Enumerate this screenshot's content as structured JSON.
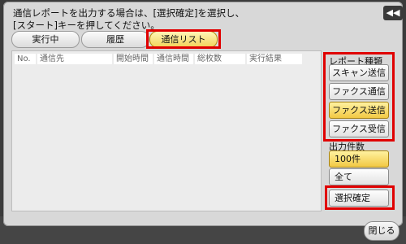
{
  "header": {
    "message_line1": "通信レポートを出力する場合は、[選択確定]を選択し、",
    "message_line2": "[スタート]キーを押してください。",
    "back_label": "◀◀"
  },
  "tabs": [
    {
      "label": "実行中",
      "active": false
    },
    {
      "label": "履歴",
      "active": false
    },
    {
      "label": "通信リスト",
      "active": true
    }
  ],
  "table": {
    "columns": [
      "No.",
      "通信先",
      "開始時間",
      "通信時間",
      "総枚数",
      "実行結果"
    ],
    "rows": []
  },
  "report_types": {
    "label": "レポート種類",
    "options": [
      {
        "label": "スキャン送信",
        "selected": false
      },
      {
        "label": "ファクス通信",
        "selected": false
      },
      {
        "label": "ファクス送信",
        "selected": true
      },
      {
        "label": "ファクス受信",
        "selected": false
      }
    ]
  },
  "output_count": {
    "label": "出力件数",
    "options": [
      {
        "label": "100件",
        "selected": true
      },
      {
        "label": "全て",
        "selected": false
      }
    ]
  },
  "confirm_label": "選択確定",
  "close_label": "閉じる",
  "background_items": [
    "",
    "",
    "",
    "",
    ""
  ],
  "colors": {
    "highlight": "#e00000",
    "selected": "#f2c944"
  }
}
